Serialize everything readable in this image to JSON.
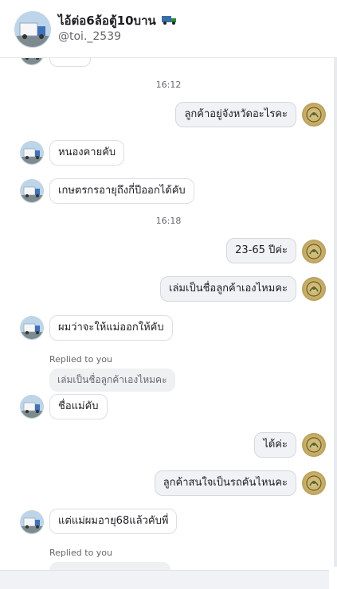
{
  "header": {
    "title": "ไอ้ต่อ6ล้อตู้10บาน",
    "username": "@toi._2539",
    "avatar_icon": "truck-avatar-icon",
    "title_emoji_icon": "truck-emoji-icon"
  },
  "partial_top_message": "ไม่ได้",
  "times": {
    "t1": "16:12",
    "t2": "16:18"
  },
  "messages": [
    {
      "dir": "out",
      "text": "ลูกค้าอยู่จังหวัดอะไรคะ"
    },
    {
      "dir": "in",
      "text": "หนองคายคับ"
    },
    {
      "dir": "in",
      "text": "เกษตรกรอายุถึงกี่ปีออกได้คับ"
    },
    {
      "dir": "out",
      "text": "23-65 ปีค่ะ"
    },
    {
      "dir": "out",
      "text": "เล่มเป็นชื่อลูกค้าเองไหมคะ"
    },
    {
      "dir": "in",
      "text": "ผมว่าจะให้แม่ออกให้คับ"
    },
    {
      "dir": "in",
      "text": "ชื่อแม่คับ"
    },
    {
      "dir": "out",
      "text": "ได้ค่ะ"
    },
    {
      "dir": "out",
      "text": "ลูกค้าสนใจเป็นรถคันไหนคะ"
    },
    {
      "dir": "in",
      "text": "แต่แม่ผมอายุ68แล้วคับพี่"
    }
  ],
  "reply1": {
    "label": "Replied to you",
    "quote": "เล่มเป็นชื่อลูกค้าเองไหมคะ"
  },
  "reply2": {
    "label": "Replied to you"
  },
  "colors": {
    "incoming_bubble": "#ffffff",
    "outgoing_bubble": "#f0f2f5",
    "muted_text": "#65676b"
  }
}
